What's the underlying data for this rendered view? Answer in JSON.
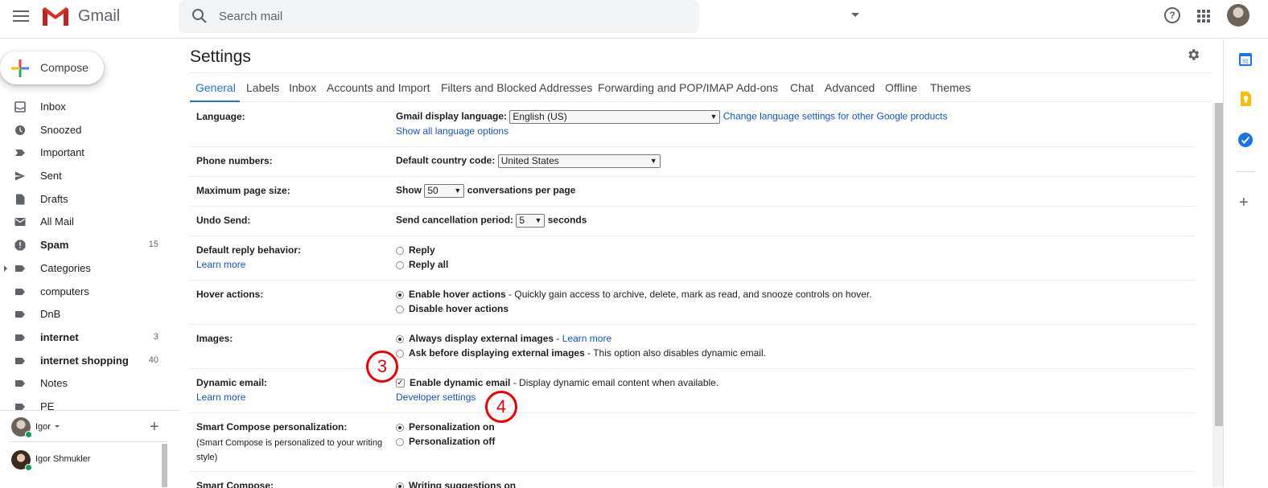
{
  "header": {
    "app_name": "Gmail",
    "search_placeholder": "Search mail",
    "help_glyph": "?"
  },
  "compose": {
    "label": "Compose"
  },
  "nav": {
    "items": [
      {
        "label": "Inbox",
        "icon": "inbox-icon",
        "count": "",
        "bold": false
      },
      {
        "label": "Snoozed",
        "icon": "clock-icon",
        "count": "",
        "bold": false
      },
      {
        "label": "Important",
        "icon": "important-icon",
        "count": "",
        "bold": false
      },
      {
        "label": "Sent",
        "icon": "send-icon",
        "count": "",
        "bold": false
      },
      {
        "label": "Drafts",
        "icon": "draft-icon",
        "count": "",
        "bold": false
      },
      {
        "label": "All Mail",
        "icon": "mail-icon",
        "count": "",
        "bold": false
      },
      {
        "label": "Spam",
        "icon": "spam-icon",
        "count": "15",
        "bold": true
      },
      {
        "label": "Categories",
        "icon": "label-icon",
        "count": "",
        "bold": false
      },
      {
        "label": "computers",
        "icon": "label-icon",
        "count": "",
        "bold": false
      },
      {
        "label": "DnB",
        "icon": "label-icon",
        "count": "",
        "bold": false
      },
      {
        "label": "internet",
        "icon": "label-icon",
        "count": "3",
        "bold": true
      },
      {
        "label": "internet shopping",
        "icon": "label-icon",
        "count": "40",
        "bold": true
      },
      {
        "label": "Notes",
        "icon": "label-icon",
        "count": "",
        "bold": false
      },
      {
        "label": "PE",
        "icon": "label-icon",
        "count": "",
        "bold": false
      }
    ]
  },
  "chat": {
    "me": "Igor",
    "add_glyph": "+",
    "contact": "Igor Shmukler"
  },
  "settings": {
    "title": "Settings",
    "tabs": [
      "General",
      "Labels",
      "Inbox",
      "Accounts and Import",
      "Filters and Blocked Addresses",
      "Forwarding and POP/IMAP",
      "Add-ons",
      "Chat",
      "Advanced",
      "Offline",
      "Themes"
    ],
    "active_tab": "General",
    "language": {
      "label": "Language:",
      "display_label": "Gmail display language:",
      "value": "English (US)",
      "change_link": "Change language settings for other Google products",
      "show_all": "Show all language options"
    },
    "phone": {
      "label": "Phone numbers:",
      "country_label": "Default country code:",
      "value": "United States"
    },
    "page_size": {
      "label": "Maximum page size:",
      "show": "Show",
      "value": "50",
      "suffix": "conversations per page"
    },
    "undo": {
      "label": "Undo Send:",
      "period_label": "Send cancellation period:",
      "value": "5",
      "suffix": "seconds"
    },
    "reply": {
      "label": "Default reply behavior:",
      "learn_more": "Learn more",
      "opt1": "Reply",
      "opt2": "Reply all"
    },
    "hover": {
      "label": "Hover actions:",
      "opt1": "Enable hover actions",
      "opt1_desc": " - Quickly gain access to archive, delete, mark as read, and snooze controls on hover.",
      "opt2": "Disable hover actions"
    },
    "images": {
      "label": "Images:",
      "opt1": "Always display external images",
      "sep": " - ",
      "learn_more": "Learn more",
      "opt2": "Ask before displaying external images",
      "opt2_desc": " - This option also disables dynamic email."
    },
    "dynamic": {
      "label": "Dynamic email:",
      "learn_more": "Learn more",
      "opt1": "Enable dynamic email",
      "opt1_desc": " - Display dynamic email content when available.",
      "dev": "Developer settings",
      "check_glyph": "✓"
    },
    "smart_compose_personal": {
      "label": "Smart Compose personalization:",
      "sub": "(Smart Compose is personalized to your writing style)",
      "opt1": "Personalization on",
      "opt2": "Personalization off"
    },
    "smart_compose": {
      "label": "Smart Compose:",
      "opt1": "Writing suggestions on"
    }
  },
  "annotations": {
    "marker_3": "3",
    "marker_4": "4"
  },
  "colors": {
    "accent": "#1a73e8",
    "link": "#1155cc",
    "marker": "#ee0000"
  }
}
